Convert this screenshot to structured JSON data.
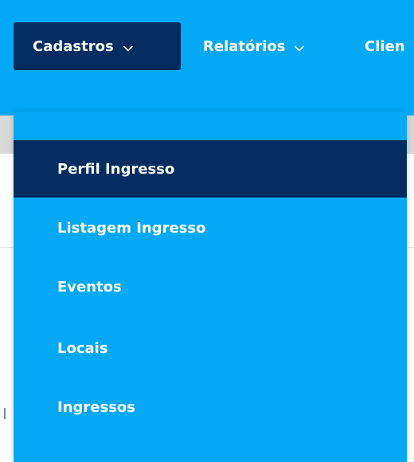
{
  "nav": {
    "items": [
      {
        "label": "Cadastros",
        "active": true,
        "icon": "chevron-down-icon"
      },
      {
        "label": "Relatórios",
        "active": false,
        "icon": "chevron-down-icon"
      },
      {
        "label": "Clien",
        "active": false
      }
    ]
  },
  "dropdown": {
    "items": [
      {
        "label": "Perfil Ingresso",
        "selected": true
      },
      {
        "label": "Listagem Ingresso",
        "selected": false
      },
      {
        "label": "Eventos",
        "selected": false
      },
      {
        "label": "Locais",
        "selected": false
      },
      {
        "label": "Ingressos",
        "selected": false
      }
    ]
  },
  "colors": {
    "primary": "#04a9f5",
    "active": "#012d60",
    "text": "#ffffff",
    "subbar": "#d9d9d9"
  }
}
